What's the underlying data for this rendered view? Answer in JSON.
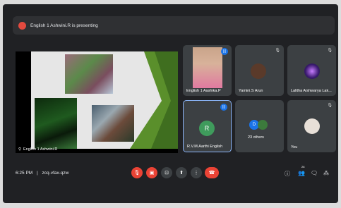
{
  "banner": {
    "presenting_text": "English 1 Ashwini.R is presenting"
  },
  "presentation": {
    "presenter_name": "English 1 Ashwini.R"
  },
  "participants": [
    {
      "name": "English 1 Aashika.P",
      "state": "speaking"
    },
    {
      "name": "Yamini.S Arun",
      "state": "muted"
    },
    {
      "name": "Lalitha Aishwarya Lak...",
      "state": "muted"
    },
    {
      "name": "R.V.M.Aarthi English",
      "state": "speaking",
      "initial": "R",
      "avatar_color": "#3f9b5c"
    },
    {
      "name": "23 others",
      "initial": "D"
    },
    {
      "name": "You",
      "state": "muted"
    }
  ],
  "bottom_bar": {
    "time": "6:25 PM",
    "separator": "|",
    "meeting_code": "zcq-vfax-qzw",
    "people_count": "26"
  },
  "colors": {
    "accent_red": "#ea4335",
    "accent_blue": "#1a73e8",
    "tile_bg": "#3c4043"
  }
}
